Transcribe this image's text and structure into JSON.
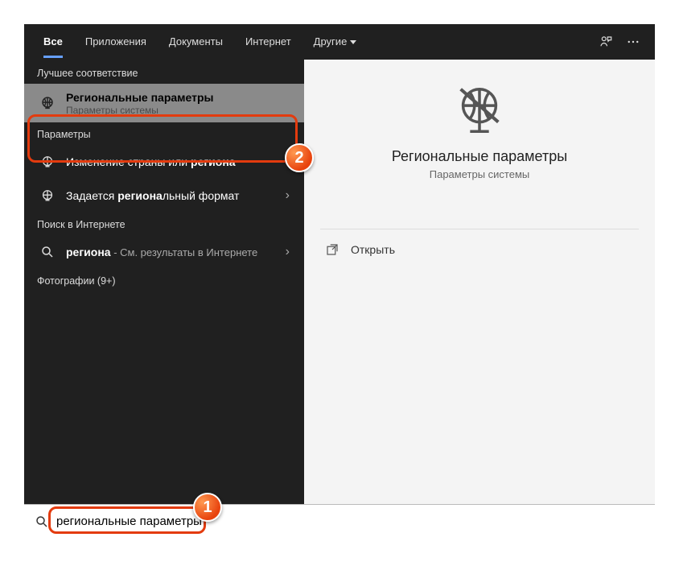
{
  "tabs": {
    "all": "Все",
    "apps": "Приложения",
    "docs": "Документы",
    "internet": "Интернет",
    "other": "Другие"
  },
  "sections": {
    "best_match": "Лучшее соответствие",
    "settings": "Параметры",
    "web_search": "Поиск в Интернете",
    "photos": "Фотографии (9+)"
  },
  "results": {
    "best": {
      "title_pre": "Региона",
      "title_post": "льные параметры",
      "subtitle": "Параметры системы"
    },
    "settings": [
      {
        "pre": "Изменение страны или ",
        "bold": "региона",
        "post": ""
      },
      {
        "pre": "Задается ",
        "bold": "региона",
        "post": "льный формат"
      }
    ],
    "web": {
      "bold": "региона",
      "extra": " - См. результаты в Интернете"
    }
  },
  "detail": {
    "title": "Региональные параметры",
    "subtitle": "Параметры системы",
    "open": "Открыть"
  },
  "search": {
    "value": "региональные параметры"
  },
  "annotations": {
    "badge1": "1",
    "badge2": "2"
  }
}
